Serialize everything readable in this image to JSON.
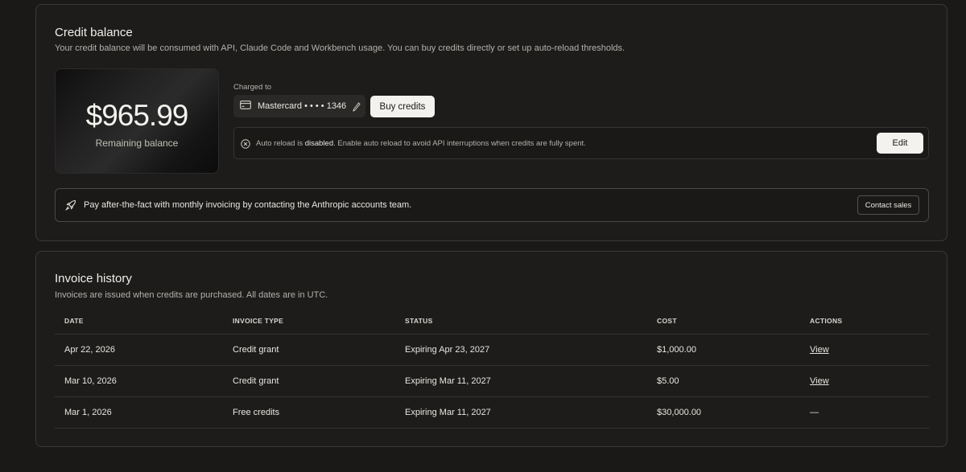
{
  "credit_balance": {
    "title": "Credit balance",
    "description": "Your credit balance will be consumed with API, Claude Code and Workbench usage. You can buy credits directly or set up auto-reload thresholds.",
    "amount": "$965.99",
    "amount_label": "Remaining balance",
    "charged_to_label": "Charged to",
    "payment_method": "Mastercard • • • • 1346",
    "buy_button": "Buy credits",
    "auto_reload": {
      "prefix": "Auto reload is ",
      "state": "disabled",
      "suffix": ". Enable auto reload to avoid API interruptions when credits are fully spent.",
      "edit_button": "Edit"
    },
    "invoicing": {
      "text": "Pay after-the-fact with monthly invoicing by contacting the Anthropic accounts team.",
      "contact_button": "Contact sales"
    }
  },
  "invoice_history": {
    "title": "Invoice history",
    "description": "Invoices are issued when credits are purchased. All dates are in UTC.",
    "columns": [
      "DATE",
      "INVOICE TYPE",
      "STATUS",
      "COST",
      "ACTIONS"
    ],
    "rows": [
      {
        "date": "Apr 22, 2026",
        "type": "Credit grant",
        "status": "Expiring Apr 23, 2027",
        "cost": "$1,000.00",
        "action": "View"
      },
      {
        "date": "Mar 10, 2026",
        "type": "Credit grant",
        "status": "Expiring Mar 11, 2027",
        "cost": "$5.00",
        "action": "View"
      },
      {
        "date": "Mar 1, 2026",
        "type": "Free credits",
        "status": "Expiring Mar 11, 2027",
        "cost": "$30,000.00",
        "action": "—"
      }
    ]
  },
  "icons": {
    "card": "credit-card-icon",
    "pencil": "pencil-icon",
    "disabled": "circle-x-icon",
    "rocket": "rocket-icon"
  }
}
